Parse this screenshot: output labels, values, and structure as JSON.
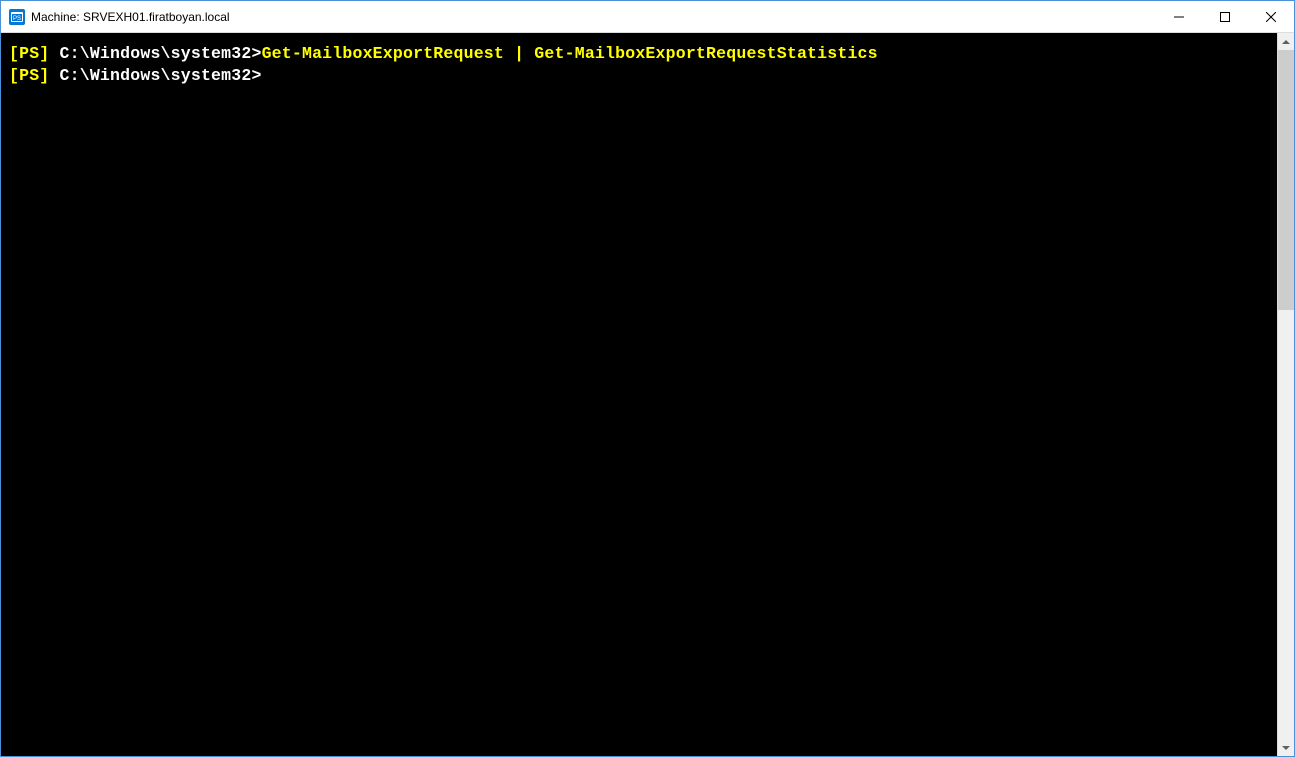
{
  "window": {
    "title": "Machine: SRVEXH01.firatboyan.local"
  },
  "terminal": {
    "lines": [
      {
        "prefix": "[PS]",
        "path": " C:\\Windows\\system32>",
        "command": "Get-MailboxExportRequest | Get-MailboxExportRequestStatistics"
      },
      {
        "prefix": "[PS]",
        "path": " C:\\Windows\\system32>",
        "command": ""
      }
    ]
  }
}
